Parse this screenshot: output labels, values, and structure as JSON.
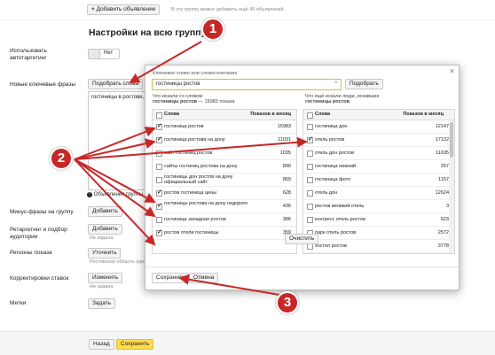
{
  "top": {
    "add_button": "Добавить объявление",
    "hint": "В эту группу можно добавить ещё 49 объявлений."
  },
  "title": "Настройки на всю группу",
  "autotargeting": {
    "label": "Использовать автотаргетинг",
    "toggle_value": "Нет"
  },
  "new_phrases": {
    "label": "Новые ключевые фразы",
    "pick_button": "Подобрать слова",
    "textarea_value": "гостиницы в ростове, гостин",
    "ads_label": "Объявления группы"
  },
  "minus": {
    "label": "Минус-фразы на группу",
    "button": "Добавить"
  },
  "retargeting": {
    "label": "Ретаргетинг и подбор аудитории",
    "button": "Добавить",
    "hint": "Не задана"
  },
  "regions": {
    "label": "Регионы показа",
    "button": "Уточнить",
    "hint": "Ростовская область (кро"
  },
  "bids": {
    "label": "Корректировки ставок",
    "button": "Изменить",
    "hint": "Не задана"
  },
  "tags": {
    "label": "Метки",
    "button": "Задать"
  },
  "popup": {
    "field_label": "Ключевое слово или словосочетание",
    "field_value": "гостиницы ростов",
    "pick_button": "Подобрать",
    "left_caption_1": "Что искали со словом",
    "left_caption_2": "гостиницы ростов",
    "left_caption_count": "— 15983 показа",
    "right_caption_1": "Что ещё искали люди, искавшие",
    "right_caption_2": "гостиницы ростов",
    "col_words": "Слова",
    "col_shows": "Показов в месяц",
    "left_rows": [
      {
        "word": "гостиница ростов",
        "count": "15983",
        "checked": true
      },
      {
        "word": "гостиница ростова на дону",
        "count": "11031",
        "checked": true
      },
      {
        "word": "сайт гостиниц ростов",
        "count": "1035",
        "checked": false
      },
      {
        "word": "сайты гостиниц ростова на дону",
        "count": "890",
        "checked": false
      },
      {
        "word": "гостиницы дон ростов на дону официальный сайт",
        "count": "869",
        "checked": false
      },
      {
        "word": "ростов гостиница цены",
        "count": "628",
        "checked": true
      },
      {
        "word": "гостиницы ростова на дону недорого",
        "count": "436",
        "checked": true
      },
      {
        "word": "гостиница западная ростов",
        "count": "386",
        "checked": false
      },
      {
        "word": "ростов отели гостиницы",
        "count": "359",
        "checked": true
      }
    ],
    "right_rows": [
      {
        "word": "гостиница дон",
        "count": "12147",
        "checked": false
      },
      {
        "word": "отель ростов",
        "count": "17132",
        "checked": true
      },
      {
        "word": "отель дон ростов",
        "count": "11635",
        "checked": false
      },
      {
        "word": "гостиница нижний",
        "count": "257",
        "checked": false
      },
      {
        "word": "гостиница фото",
        "count": "1157",
        "checked": false
      },
      {
        "word": "отель дон",
        "count": "12624",
        "checked": false
      },
      {
        "word": "ростов великий отель",
        "count": "3",
        "checked": false
      },
      {
        "word": "конгресс отель ростов",
        "count": "623",
        "checked": false
      },
      {
        "word": "парк отель ростов",
        "count": "2572",
        "checked": false
      },
      {
        "word": "хостел ростов",
        "count": "3778",
        "checked": false
      }
    ],
    "clear_button": "Очистить",
    "save_button": "Сохранить",
    "cancel_button": "Отмена"
  },
  "bottom": {
    "back_button": "Назад",
    "save_button": "Сохранить"
  },
  "annotations": [
    "1",
    "2",
    "3"
  ],
  "colors": {
    "accent_yellow": "#ffdb4d",
    "badge_red": "#c62828"
  }
}
